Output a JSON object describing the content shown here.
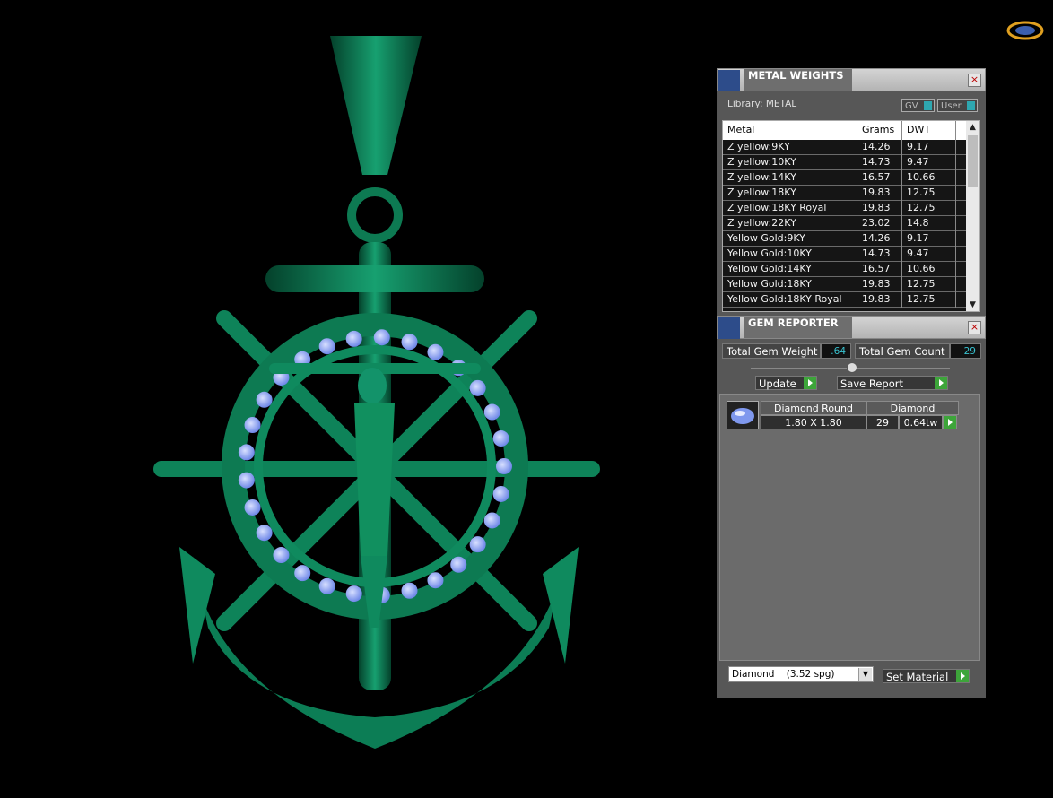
{
  "metal_weights": {
    "title": "METAL WEIGHTS",
    "close": "×",
    "library_label": "Library: METAL",
    "toggle_gv": "GV",
    "toggle_user": "User",
    "columns": [
      "Metal",
      "Grams",
      "DWT"
    ],
    "rows": [
      {
        "metal": "Z yellow:9KY",
        "grams": "14.26",
        "dwt": "9.17"
      },
      {
        "metal": "Z yellow:10KY",
        "grams": "14.73",
        "dwt": "9.47"
      },
      {
        "metal": "Z yellow:14KY",
        "grams": "16.57",
        "dwt": "10.66"
      },
      {
        "metal": "Z yellow:18KY",
        "grams": "19.83",
        "dwt": "12.75"
      },
      {
        "metal": "Z yellow:18KY Royal",
        "grams": "19.83",
        "dwt": "12.75"
      },
      {
        "metal": "Z yellow:22KY",
        "grams": "23.02",
        "dwt": "14.8"
      },
      {
        "metal": "Yellow Gold:9KY",
        "grams": "14.26",
        "dwt": "9.17"
      },
      {
        "metal": "Yellow Gold:10KY",
        "grams": "14.73",
        "dwt": "9.47"
      },
      {
        "metal": "Yellow Gold:14KY",
        "grams": "16.57",
        "dwt": "10.66"
      },
      {
        "metal": "Yellow Gold:18KY",
        "grams": "19.83",
        "dwt": "12.75"
      },
      {
        "metal": "Yellow Gold:18KY Royal",
        "grams": "19.83",
        "dwt": "12.75"
      }
    ]
  },
  "gem_reporter": {
    "title": "GEM REPORTER",
    "close": "×",
    "total_weight_label": "Total Gem Weight",
    "total_weight_value": ".64",
    "total_count_label": "Total Gem Count",
    "total_count_value": "29",
    "update_label": "Update",
    "save_report_label": "Save Report",
    "gem": {
      "shape": "Diamond Round",
      "size": "1.80 X 1.80",
      "material": "Diamond",
      "count": "29",
      "weight": "0.64tw"
    },
    "material_select": "Diamond    (3.52 spg)",
    "set_material_label": "Set Material"
  },
  "colors": {
    "model_green": "#0f8a5e",
    "gem_blue": "#8fa8ff",
    "go_green": "#3da53a",
    "value_cyan": "#39c2cf"
  }
}
